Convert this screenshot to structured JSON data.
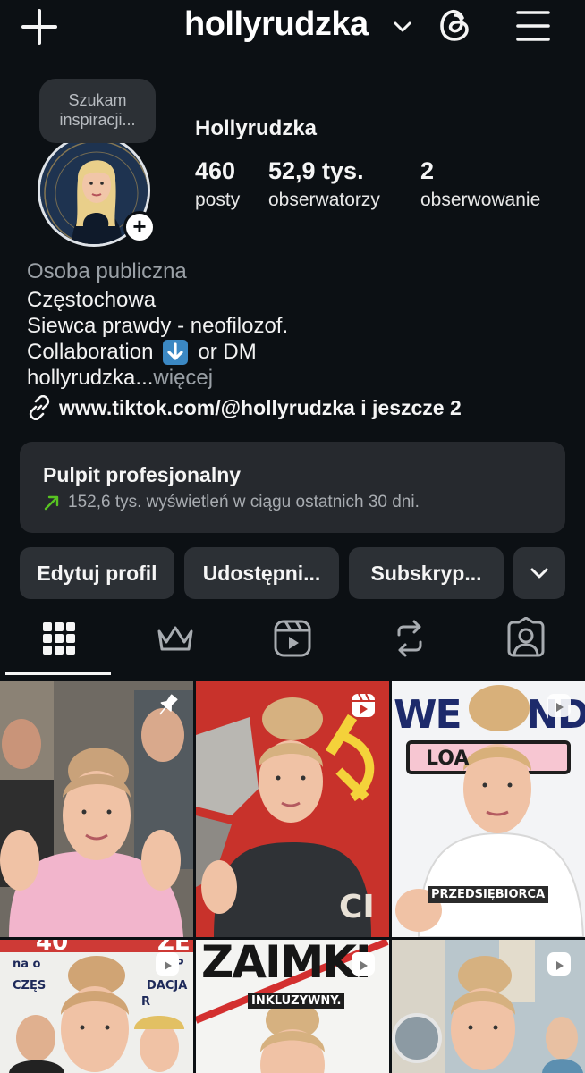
{
  "topbar": {
    "username": "hollyrudzka"
  },
  "profile": {
    "note": "Szukam inspiracji...",
    "display_name": "Hollyrudzka",
    "stats": [
      {
        "value": "460",
        "label": "posty"
      },
      {
        "value": "52,9 tys.",
        "label": "obserwatorzy"
      },
      {
        "value": "2",
        "label": "obserwowanie"
      }
    ],
    "category": "Osoba publiczna",
    "bio_lines": [
      "Częstochowa",
      "Siewca prawdy - neofilozof."
    ],
    "bio_collab_before": "Collaboration",
    "bio_collab_after": "or DM",
    "bio_truncated": "hollyrudzka...",
    "more_label": "więcej",
    "link": "www.tiktok.com/@hollyrudzka i jeszcze 2"
  },
  "dashboard": {
    "title": "Pulpit profesjonalny",
    "subtitle": "152,6 tys. wyświetleń w ciągu ostatnich 30 dni."
  },
  "actions": {
    "edit": "Edytuj profil",
    "share": "Udostępni...",
    "subscribe": "Subskryp..."
  },
  "tabs": [
    "grid-icon",
    "crown-icon",
    "reels-icon",
    "reposts-icon",
    "tagged-icon"
  ],
  "grid": {
    "tile3_text_top": "WE",
    "tile3_text_top2": "ND",
    "tile3_box": "LOA",
    "tile3_caption": "PRZEDSIĘBIORCA",
    "tile2_text": "CI",
    "tile4_line1": "na o",
    "tile4_line2": "CZĘS",
    "tile4_right1": "P",
    "tile4_right2": "DACJA",
    "tile4_right3": "R",
    "tile4_top": "40",
    "tile4_top2": "ZE",
    "tile5_title": "ZAIMKI",
    "tile5_sub": "INKLUZYWNY."
  },
  "colors": {
    "background": "#0c1014",
    "card": "#26292e",
    "button": "#2c3035",
    "accent_green": "#58c322"
  }
}
